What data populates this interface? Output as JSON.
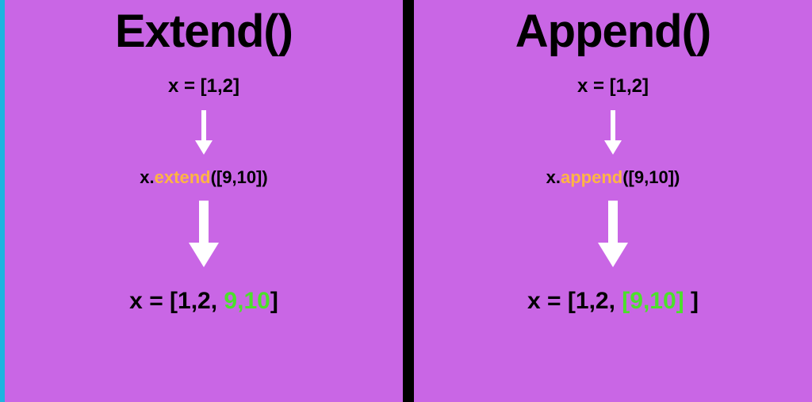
{
  "left": {
    "title": "Extend()",
    "initial": "x = [1,2]",
    "op_prefix": "x.",
    "op_method": "extend",
    "op_suffix": "([9,10])",
    "result_prefix": "x = [1,2, ",
    "result_added": "9,10",
    "result_suffix": "]"
  },
  "right": {
    "title": "Append()",
    "initial": "x = [1,2]",
    "op_prefix": "x.",
    "op_method": "append",
    "op_suffix": "([9,10])",
    "result_prefix": "x = [1,2, ",
    "result_added": "[9,10]",
    "result_suffix": " ]"
  }
}
